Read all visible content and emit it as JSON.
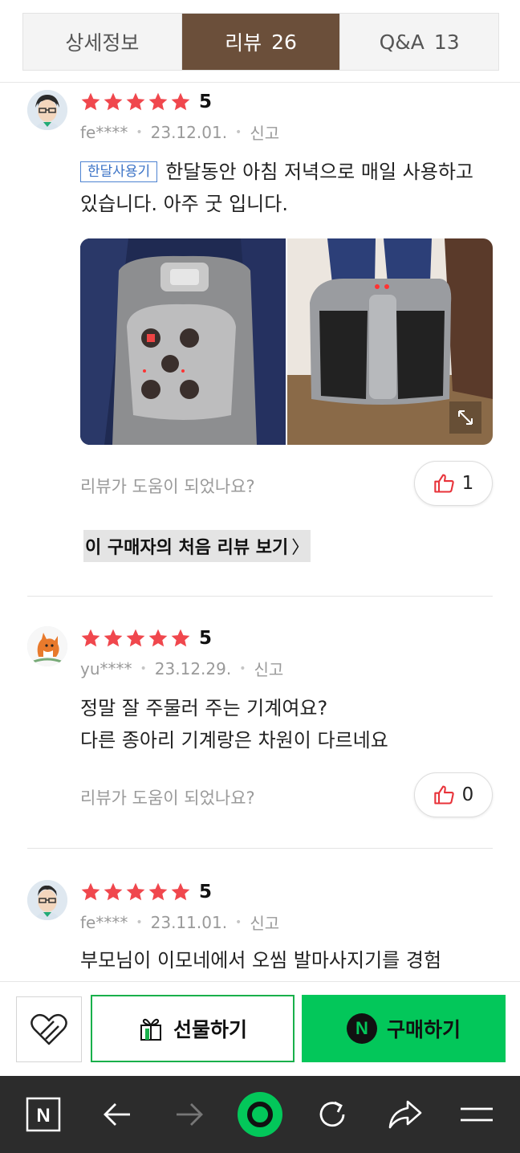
{
  "tabs": [
    {
      "label": "상세정보",
      "count": ""
    },
    {
      "label": "리뷰",
      "count": "26"
    },
    {
      "label": "Q&A",
      "count": "13"
    }
  ],
  "reviews": [
    {
      "score": "5",
      "user": "fe****",
      "date": "23.12.01.",
      "report": "신고",
      "badge": "한달사용기",
      "text": "한달동안 아침 저녁으로 매일 사용하고 있습니다. 아주 굿 입니다.",
      "helpful_question": "리뷰가 도움이 되었나요?",
      "likes": "1",
      "first_review_link": "이 구매자의 처음 리뷰 보기"
    },
    {
      "score": "5",
      "user": "yu****",
      "date": "23.12.29.",
      "report": "신고",
      "text_line1": "정말 잘 주물러 주는 기계여요?",
      "text_line2": "다른 종아리 기계랑은 차원이 다르네요",
      "helpful_question": "리뷰가 도움이 되었나요?",
      "likes": "0"
    },
    {
      "score": "5",
      "user": "fe****",
      "date": "23.11.01.",
      "report": "신고",
      "text": "부모님이 이모네에서 오씸 발마사지기를 경험"
    }
  ],
  "actions": {
    "gift_label": "선물하기",
    "buy_label": "구매하기",
    "npay_letter": "N"
  },
  "navbar": {
    "home_letter": "N"
  },
  "icons": {
    "star": "star-icon",
    "like": "thumbs-up-icon",
    "wish": "heart-icon",
    "gift": "gift-icon"
  },
  "colors": {
    "tab_active": "#6b4f3a",
    "star": "#f0474d",
    "buy": "#03c75a",
    "gift_border": "#19b04b",
    "badge": "#3a72c6"
  }
}
